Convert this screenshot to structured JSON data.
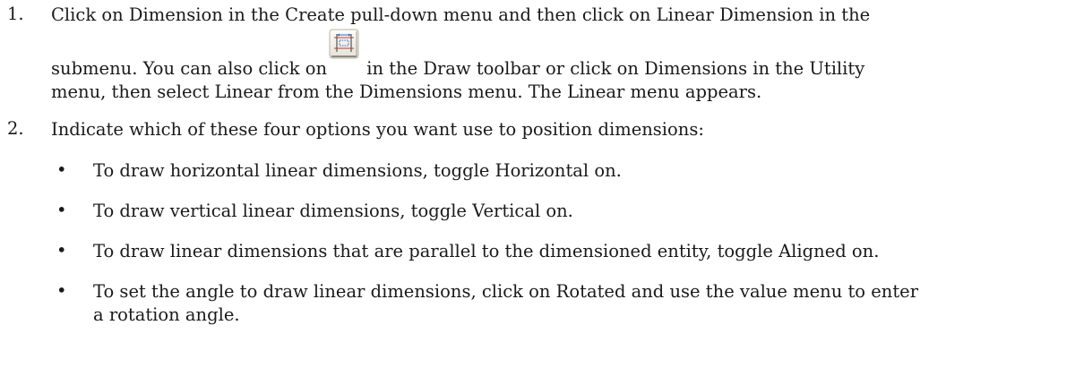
{
  "steps": [
    {
      "number": "1.",
      "line1": "Click on Dimension in the Create pull-down menu and then click on Linear Dimension in the",
      "line2_before_icon": "submenu. You can also click on",
      "line2_after_icon": " in the Draw toolbar or click on Dimensions in the Utility",
      "line3": "menu, then select Linear from the Dimensions menu. The Linear menu appears.",
      "icon": "linear-dimension-toolbar-icon"
    },
    {
      "number": "2.",
      "text": "Indicate which of these four options you want use to position dimensions:"
    }
  ],
  "bullets": [
    {
      "marker": "•",
      "line1": "To draw horizontal linear dimensions, toggle Horizontal on."
    },
    {
      "marker": "•",
      "line1": "To draw vertical linear dimensions, toggle Vertical on."
    },
    {
      "marker": "•",
      "line1": "To draw linear dimensions that are parallel to the dimensioned entity, toggle Aligned on."
    },
    {
      "marker": "•",
      "line1": "To set the angle to draw linear dimensions, click on Rotated and use the value menu to enter",
      "line2": "a rotation angle."
    }
  ]
}
